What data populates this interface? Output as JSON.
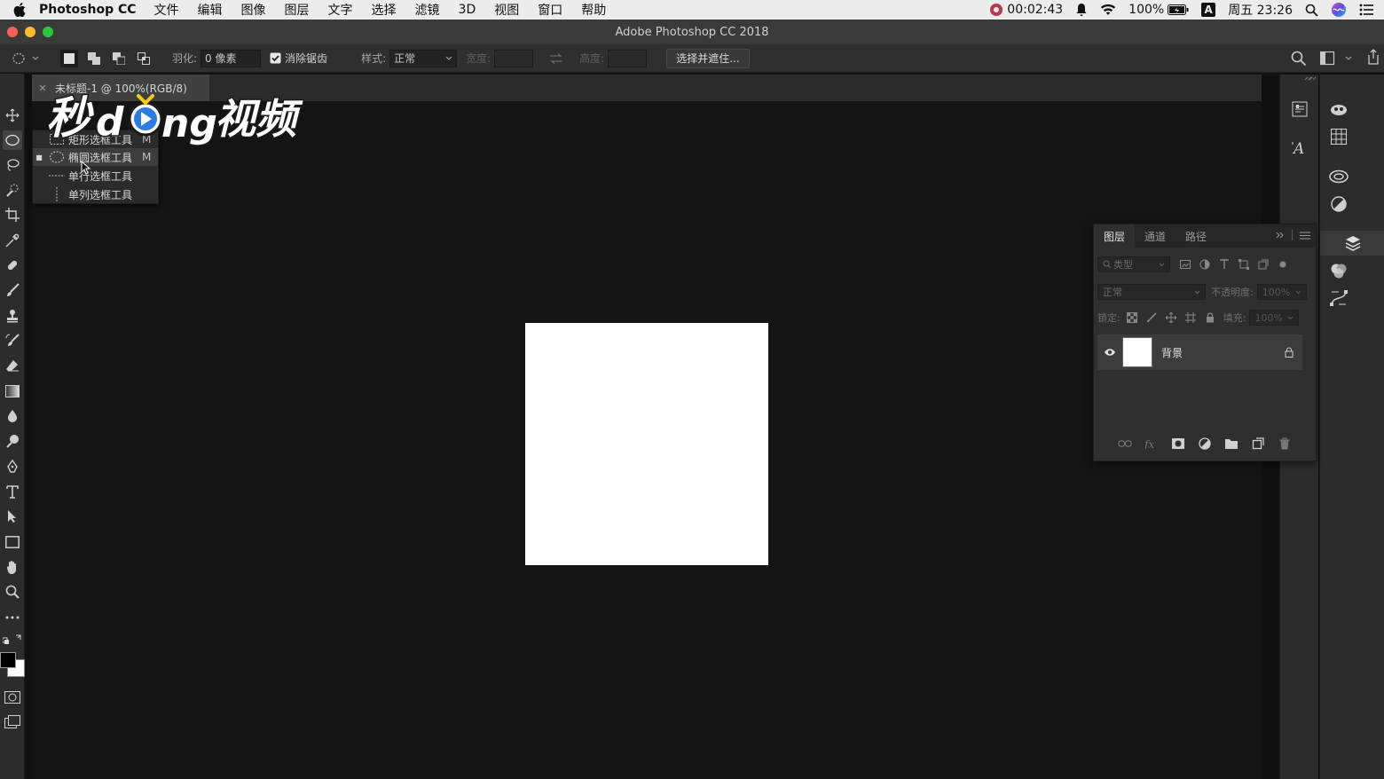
{
  "menubar": {
    "app_name": "Photoshop CC",
    "items": [
      "文件",
      "编辑",
      "图像",
      "图层",
      "文字",
      "选择",
      "滤镜",
      "3D",
      "视图",
      "窗口",
      "帮助"
    ],
    "recording_time": "00:02:43",
    "battery": "100%",
    "input_method": "A",
    "clock": "周五 23:26"
  },
  "window": {
    "title": "Adobe Photoshop CC 2018"
  },
  "options_bar": {
    "feather_label": "羽化:",
    "feather_value": "0 像素",
    "antialias_label": "消除锯齿",
    "antialias_checked": true,
    "style_label": "样式:",
    "style_value": "正常",
    "width_label": "宽度:",
    "height_label": "高度:",
    "select_mask_button": "选择并遮住..."
  },
  "document": {
    "tab_title": "未标题-1 @ 100%(RGB/8)",
    "canvas_color": "#ffffff"
  },
  "tool_flyout": {
    "items": [
      {
        "label": "矩形选框工具",
        "shortcut": "M",
        "selected": false
      },
      {
        "label": "椭圆选框工具",
        "shortcut": "M",
        "selected": true
      },
      {
        "label": "单行选框工具",
        "shortcut": "",
        "selected": false
      },
      {
        "label": "单列选框工具",
        "shortcut": "",
        "selected": false
      }
    ]
  },
  "watermark": {
    "text": "秒dong视频"
  },
  "layers_panel": {
    "tabs": [
      "图层",
      "通道",
      "路径"
    ],
    "active_tab": "图层",
    "filter_kind": "类型",
    "blend_mode": "正常",
    "opacity_label": "不透明度:",
    "opacity_value": "100%",
    "lock_label": "锁定:",
    "fill_label": "填充:",
    "fill_value": "100%",
    "layers": [
      {
        "name": "背景",
        "visible": true,
        "locked": true
      }
    ]
  },
  "colors": {
    "foreground": "#000000",
    "background": "#ffffff",
    "ui_dark": "#2c2c2c"
  }
}
